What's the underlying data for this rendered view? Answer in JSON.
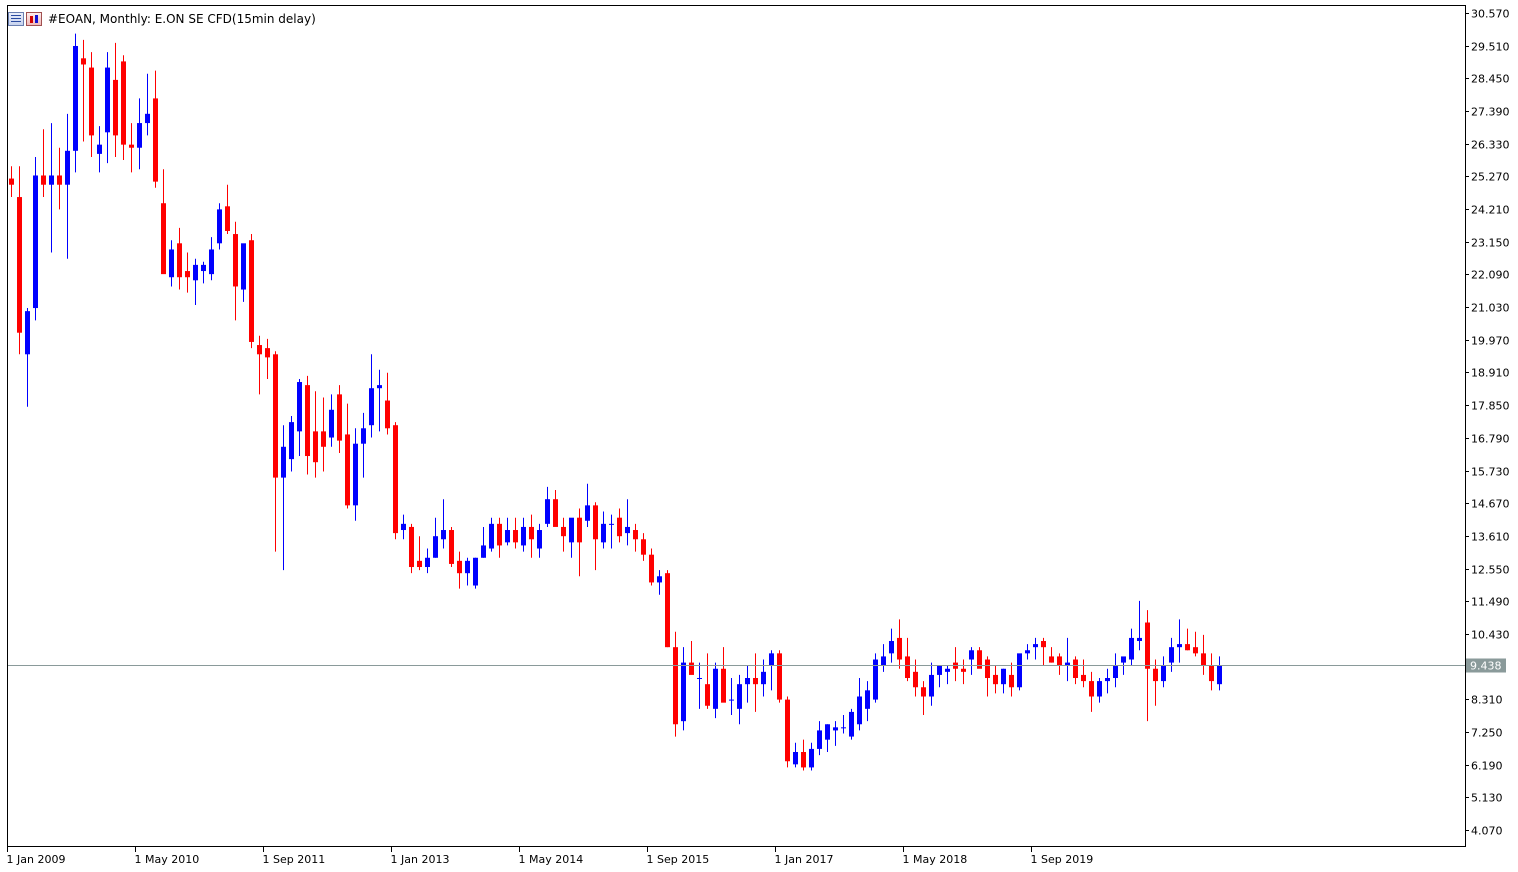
{
  "header": {
    "symbol": "#EOAN",
    "timeframe": "Monthly",
    "description": "E.ON SE CFD(15min delay)",
    "title": "#EOAN, Monthly:  E.ON SE CFD(15min delay)",
    "icons": [
      "chart-list-icon",
      "ohlc-window-icon"
    ]
  },
  "colors": {
    "background": "#ffffff",
    "bull": "#0000ff",
    "bear": "#ff0000",
    "wick": "#000000",
    "bid_line": "#8a9a9a",
    "bid_label_bg": "#8a9a9a",
    "bid_label_text": "#ffffff",
    "frame": "#000000"
  },
  "chart_data": {
    "type": "candlestick",
    "ylim": [
      3.6,
      30.8
    ],
    "y_ticks": [
      "30.570",
      "29.510",
      "28.450",
      "27.390",
      "26.330",
      "25.270",
      "24.210",
      "23.150",
      "22.090",
      "21.030",
      "19.970",
      "18.910",
      "17.850",
      "16.790",
      "15.730",
      "14.670",
      "13.610",
      "12.550",
      "11.490",
      "10.430",
      "9.438",
      "8.310",
      "7.250",
      "6.190",
      "5.130",
      "4.070"
    ],
    "x_ticks": [
      {
        "label": "1 Jan 2009",
        "index": 0
      },
      {
        "label": "1 May 2010",
        "index": 16
      },
      {
        "label": "1 Sep 2011",
        "index": 32
      },
      {
        "label": "1 Jan 2013",
        "index": 48
      },
      {
        "label": "1 May 2014",
        "index": 64
      },
      {
        "label": "1 Sep 2015",
        "index": 80
      },
      {
        "label": "1 Jan 2017",
        "index": 96
      },
      {
        "label": "1 May 2018",
        "index": 112
      },
      {
        "label": "1 Sep 2019",
        "index": 128
      }
    ],
    "current_bid": "9.438",
    "candles": [
      [
        25.2,
        25.6,
        24.6,
        25.0
      ],
      [
        24.6,
        25.6,
        19.5,
        20.2
      ],
      [
        19.5,
        21.0,
        17.8,
        20.9
      ],
      [
        21.0,
        25.9,
        20.6,
        25.3
      ],
      [
        25.3,
        26.8,
        24.6,
        25.0
      ],
      [
        25.0,
        27.0,
        22.8,
        25.3
      ],
      [
        25.3,
        26.2,
        24.2,
        25.0
      ],
      [
        25.0,
        27.3,
        22.6,
        26.1
      ],
      [
        26.1,
        29.9,
        25.4,
        29.5
      ],
      [
        29.1,
        29.7,
        26.4,
        28.9
      ],
      [
        28.8,
        29.3,
        25.9,
        26.6
      ],
      [
        26.0,
        26.9,
        25.4,
        26.3
      ],
      [
        26.7,
        29.3,
        25.7,
        28.8
      ],
      [
        28.4,
        29.6,
        25.9,
        26.6
      ],
      [
        29.0,
        29.2,
        25.8,
        26.3
      ],
      [
        26.3,
        27.0,
        25.4,
        26.2
      ],
      [
        26.2,
        27.8,
        25.5,
        27.0
      ],
      [
        27.0,
        28.6,
        26.6,
        27.3
      ],
      [
        27.8,
        28.7,
        24.9,
        25.1
      ],
      [
        24.4,
        25.5,
        22.6,
        22.1
      ],
      [
        22.0,
        23.2,
        21.7,
        22.9
      ],
      [
        23.1,
        23.6,
        21.6,
        22.0
      ],
      [
        22.2,
        22.8,
        21.5,
        22.0
      ],
      [
        21.9,
        22.6,
        21.1,
        22.4
      ],
      [
        22.2,
        22.5,
        21.8,
        22.4
      ],
      [
        22.1,
        23.3,
        21.9,
        22.9
      ],
      [
        23.1,
        24.4,
        22.9,
        24.2
      ],
      [
        24.3,
        25.0,
        23.4,
        23.5
      ],
      [
        23.4,
        23.8,
        20.6,
        21.7
      ],
      [
        21.6,
        23.0,
        21.2,
        23.1
      ],
      [
        23.2,
        23.4,
        19.7,
        19.9
      ],
      [
        19.8,
        20.1,
        18.2,
        19.5
      ],
      [
        19.7,
        20.0,
        18.7,
        19.4
      ],
      [
        19.5,
        19.6,
        13.1,
        15.5
      ],
      [
        15.5,
        17.2,
        12.5,
        16.5
      ],
      [
        16.1,
        17.5,
        15.7,
        17.3
      ],
      [
        17.0,
        18.7,
        16.2,
        18.6
      ],
      [
        18.5,
        18.8,
        15.6,
        16.2
      ],
      [
        17.0,
        18.3,
        15.5,
        16.0
      ],
      [
        17.0,
        18.1,
        15.7,
        16.5
      ],
      [
        16.8,
        18.2,
        16.5,
        17.7
      ],
      [
        18.2,
        18.5,
        16.3,
        16.7
      ],
      [
        16.9,
        17.9,
        14.5,
        14.6
      ],
      [
        14.6,
        17.1,
        14.1,
        16.6
      ],
      [
        16.6,
        17.6,
        15.5,
        17.1
      ],
      [
        17.2,
        19.5,
        16.8,
        18.4
      ],
      [
        18.4,
        19.0,
        17.0,
        18.5
      ],
      [
        18.0,
        18.9,
        16.9,
        17.1
      ],
      [
        17.2,
        17.3,
        13.5,
        13.7
      ],
      [
        13.8,
        14.3,
        13.5,
        14.0
      ],
      [
        13.9,
        14.0,
        12.4,
        12.6
      ],
      [
        12.8,
        13.6,
        12.5,
        12.6
      ],
      [
        12.6,
        13.2,
        12.4,
        12.9
      ],
      [
        12.9,
        14.2,
        12.9,
        13.6
      ],
      [
        13.5,
        14.8,
        13.2,
        13.8
      ],
      [
        13.8,
        13.9,
        12.6,
        12.7
      ],
      [
        12.8,
        13.1,
        11.9,
        12.4
      ],
      [
        12.4,
        12.9,
        12.0,
        12.8
      ],
      [
        12.0,
        12.9,
        11.9,
        12.9
      ],
      [
        12.9,
        13.9,
        12.9,
        13.3
      ],
      [
        13.2,
        14.2,
        13.1,
        14.0
      ],
      [
        14.0,
        14.2,
        12.9,
        13.3
      ],
      [
        13.4,
        14.2,
        13.3,
        13.8
      ],
      [
        13.8,
        14.2,
        13.2,
        13.4
      ],
      [
        13.3,
        14.2,
        13.1,
        13.9
      ],
      [
        13.9,
        14.3,
        12.9,
        13.5
      ],
      [
        13.2,
        14.0,
        12.9,
        13.8
      ],
      [
        14.0,
        15.2,
        13.9,
        14.8
      ],
      [
        14.8,
        15.1,
        14.1,
        13.9
      ],
      [
        13.9,
        14.2,
        13.1,
        13.6
      ],
      [
        13.4,
        14.0,
        12.9,
        14.2
      ],
      [
        14.2,
        14.5,
        12.3,
        13.4
      ],
      [
        14.1,
        15.3,
        13.9,
        14.6
      ],
      [
        14.6,
        14.7,
        12.5,
        13.5
      ],
      [
        13.4,
        14.4,
        13.2,
        14.0
      ],
      [
        14.0,
        14.3,
        13.2,
        14.0
      ],
      [
        14.2,
        14.5,
        13.4,
        13.6
      ],
      [
        13.7,
        14.8,
        13.3,
        13.9
      ],
      [
        13.8,
        14.0,
        13.1,
        13.5
      ],
      [
        13.5,
        13.7,
        12.8,
        13.0
      ],
      [
        13.0,
        13.2,
        12.0,
        12.1
      ],
      [
        12.1,
        12.5,
        11.7,
        12.3
      ],
      [
        12.4,
        12.5,
        10.0,
        10.0
      ],
      [
        10.0,
        10.5,
        7.1,
        7.5
      ],
      [
        7.6,
        10.0,
        7.3,
        9.5
      ],
      [
        9.5,
        10.2,
        9.2,
        9.1
      ],
      [
        9.0,
        9.5,
        8.0,
        9.0
      ],
      [
        8.8,
        9.8,
        8.0,
        8.1
      ],
      [
        8.0,
        9.5,
        7.7,
        9.3
      ],
      [
        9.3,
        10.0,
        8.4,
        8.2
      ],
      [
        8.3,
        9.0,
        7.8,
        8.3
      ],
      [
        8.0,
        9.1,
        7.5,
        8.8
      ],
      [
        8.8,
        9.4,
        8.2,
        9.0
      ],
      [
        9.0,
        9.8,
        7.9,
        8.8
      ],
      [
        8.8,
        9.6,
        8.4,
        9.2
      ],
      [
        9.4,
        9.9,
        8.6,
        9.8
      ],
      [
        9.8,
        9.9,
        8.2,
        8.3
      ],
      [
        8.3,
        8.4,
        6.1,
        6.3
      ],
      [
        6.2,
        6.9,
        6.1,
        6.6
      ],
      [
        6.6,
        7.0,
        6.0,
        6.1
      ],
      [
        6.1,
        6.9,
        6.0,
        6.7
      ],
      [
        6.7,
        7.6,
        6.5,
        7.3
      ],
      [
        7.0,
        7.5,
        6.6,
        7.5
      ],
      [
        7.3,
        7.6,
        6.8,
        7.4
      ],
      [
        7.4,
        7.8,
        7.2,
        7.4
      ],
      [
        7.1,
        8.0,
        7.0,
        7.9
      ],
      [
        7.5,
        9.0,
        7.3,
        8.4
      ],
      [
        8.0,
        8.9,
        7.6,
        8.6
      ],
      [
        8.3,
        9.8,
        8.2,
        9.6
      ],
      [
        9.4,
        10.1,
        9.2,
        9.7
      ],
      [
        9.8,
        10.6,
        9.5,
        10.2
      ],
      [
        10.3,
        10.9,
        9.3,
        9.6
      ],
      [
        9.7,
        10.3,
        8.9,
        9.0
      ],
      [
        9.2,
        9.6,
        8.4,
        8.7
      ],
      [
        8.7,
        8.9,
        7.8,
        8.4
      ],
      [
        8.4,
        9.5,
        8.1,
        9.1
      ],
      [
        9.1,
        9.3,
        8.7,
        9.4
      ],
      [
        9.2,
        9.4,
        8.8,
        9.3
      ],
      [
        9.5,
        10.0,
        8.9,
        9.3
      ],
      [
        9.3,
        9.6,
        8.8,
        9.2
      ],
      [
        9.6,
        10.0,
        9.1,
        9.9
      ],
      [
        9.9,
        10.0,
        9.4,
        9.3
      ],
      [
        9.6,
        9.7,
        8.4,
        9.0
      ],
      [
        9.1,
        9.4,
        8.5,
        8.8
      ],
      [
        8.8,
        9.3,
        8.5,
        9.3
      ],
      [
        9.1,
        9.5,
        8.4,
        8.7
      ],
      [
        8.7,
        9.6,
        8.6,
        9.8
      ],
      [
        9.8,
        10.1,
        9.6,
        9.9
      ],
      [
        10.0,
        10.3,
        9.6,
        10.1
      ],
      [
        10.2,
        10.3,
        9.4,
        10.0
      ],
      [
        9.7,
        10.0,
        9.5,
        9.5
      ],
      [
        9.7,
        9.8,
        9.1,
        9.4
      ],
      [
        9.4,
        10.3,
        8.9,
        9.5
      ],
      [
        9.6,
        9.7,
        8.8,
        9.0
      ],
      [
        9.1,
        9.6,
        8.7,
        8.9
      ],
      [
        8.9,
        9.2,
        7.9,
        8.4
      ],
      [
        8.4,
        9.0,
        8.2,
        8.9
      ],
      [
        8.9,
        9.3,
        8.5,
        9.0
      ],
      [
        9.0,
        9.8,
        8.7,
        9.4
      ],
      [
        9.5,
        9.6,
        9.1,
        9.7
      ],
      [
        9.6,
        10.6,
        9.4,
        10.3
      ],
      [
        10.2,
        11.5,
        9.9,
        10.3
      ],
      [
        10.8,
        11.2,
        7.6,
        9.3
      ],
      [
        9.3,
        9.6,
        8.1,
        8.9
      ],
      [
        8.9,
        9.7,
        8.7,
        9.4
      ],
      [
        9.5,
        10.3,
        9.2,
        10.0
      ],
      [
        10.0,
        10.9,
        9.5,
        10.1
      ],
      [
        10.1,
        10.6,
        9.9,
        9.9
      ],
      [
        10.0,
        10.5,
        9.7,
        9.8
      ],
      [
        9.8,
        10.4,
        9.1,
        9.4
      ],
      [
        9.4,
        9.8,
        8.6,
        8.9
      ],
      [
        8.8,
        9.7,
        8.6,
        9.4
      ]
    ]
  }
}
